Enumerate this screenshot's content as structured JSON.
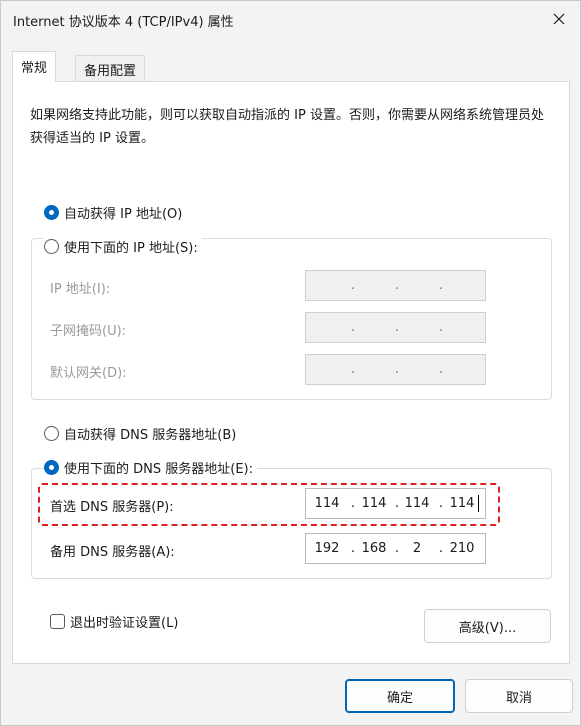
{
  "window": {
    "title": "Internet 协议版本 4 (TCP/IPv4) 属性"
  },
  "tabs": [
    {
      "label": "常规",
      "active": true
    },
    {
      "label": "备用配置",
      "active": false
    }
  ],
  "description": "如果网络支持此功能，则可以获取自动指派的 IP 设置。否则，你需要从网络系统管理员处获得适当的 IP 设置。",
  "ip_mode": {
    "auto_label": "自动获得 IP 地址(O)",
    "manual_label": "使用下面的 IP 地址(S):",
    "selected": "auto"
  },
  "ip_fields": {
    "ip_label": "IP 地址(I):",
    "subnet_label": "子网掩码(U):",
    "gateway_label": "默认网关(D):",
    "dot": "."
  },
  "dns_mode": {
    "auto_label": "自动获得 DNS 服务器地址(B)",
    "manual_label": "使用下面的 DNS 服务器地址(E):",
    "selected": "manual"
  },
  "dns_fields": {
    "preferred_label": "首选 DNS 服务器(P):",
    "preferred_value": [
      "114",
      "114",
      "114",
      "114"
    ],
    "alternate_label": "备用 DNS 服务器(A):",
    "alternate_value": [
      "192",
      "168",
      "2",
      "210"
    ]
  },
  "validate_on_exit": {
    "label": "退出时验证设置(L)",
    "checked": false
  },
  "buttons": {
    "advanced": "高级(V)...",
    "ok": "确定",
    "cancel": "取消"
  },
  "colors": {
    "accent": "#0067c0",
    "highlight": "#e02020"
  }
}
